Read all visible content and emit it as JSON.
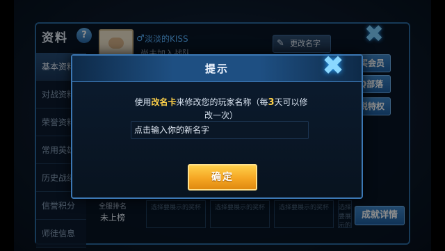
{
  "background": {
    "panel_title": "资料",
    "help_icon": "?",
    "sidebar": [
      {
        "label": "基本资料",
        "active": true
      },
      {
        "label": "对战资料",
        "active": false
      },
      {
        "label": "荣誉资料",
        "active": false
      },
      {
        "label": "常用英雄",
        "active": false
      },
      {
        "label": "历史战绩",
        "active": false
      },
      {
        "label": "信誉积分",
        "active": false
      },
      {
        "label": "师徒信息",
        "active": false
      }
    ],
    "player_name": "淡淡的KISS",
    "player_sub": "尚未加入战队",
    "rename_label": "更改名字",
    "right_buttons": [
      "购买会员",
      "QQ部落",
      "心悦特权"
    ],
    "rank_label": "全服排名",
    "rank_value": "未上榜",
    "trophy_slots": [
      "选择要展示的奖杯",
      "选择要展示的奖杯",
      "选择要展示的奖杯",
      "选择要展示的奖杯"
    ],
    "achievement_label": "成就详情"
  },
  "dialog": {
    "title": "提示",
    "message_prefix": "使用",
    "card_name": "改名卡",
    "message_middle": "来修改您的玩家名称（每",
    "days": "3",
    "message_suffix": "天可以修改一次）",
    "input_placeholder": "点击输入你的新名字",
    "confirm_label": "确定"
  },
  "colors": {
    "highlight": "#ffd24a",
    "accent_blue": "#3f86c8",
    "confirm_gold": "#f5a623"
  }
}
